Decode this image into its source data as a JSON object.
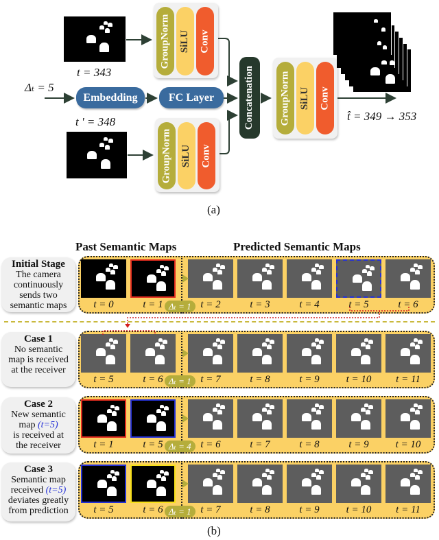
{
  "part_a": {
    "caption": "(a)",
    "input_top": {
      "label": "t = 343"
    },
    "input_bottom": {
      "label": "t ' = 348"
    },
    "delta_input": "Δₜ = 5",
    "embedding": "Embedding",
    "fc_layer": "FC Layer",
    "concatenation": "Concatenation",
    "block_layers": [
      "GroupNorm",
      "SiLU",
      "Conv"
    ],
    "output_label": "t̂ = 349 → 353",
    "colors": {
      "groupnorm": "#b5ad3b",
      "silu": "#fbd165",
      "conv": "#f05c2d",
      "blue_block": "#3a6b9e",
      "concat": "#26392c"
    }
  },
  "part_b": {
    "caption": "(b)",
    "headers": {
      "past": "Past Semantic Maps",
      "predicted": "Predicted Semantic Maps"
    },
    "rows": [
      {
        "title": "Initial Stage",
        "desc": [
          "The camera",
          "continuously",
          "sends two",
          "semantic maps"
        ],
        "past": [
          {
            "t": "t = 0",
            "style": "black"
          },
          {
            "t": "t = 1",
            "style": "black-red"
          }
        ],
        "delta": "Δₜ = 1",
        "predicted": [
          {
            "t": "t = 2"
          },
          {
            "t": "t = 3"
          },
          {
            "t": "t = 4"
          },
          {
            "t": "t = 5",
            "highlight": "dashed-blue"
          },
          {
            "t": "t = 6"
          }
        ]
      },
      {
        "title": "Case 1",
        "desc": [
          "No semantic",
          "map is received",
          "at the receiver"
        ],
        "past": [
          {
            "t": "t = 5",
            "style": "gray"
          },
          {
            "t": "t = 6",
            "style": "gray"
          }
        ],
        "delta": "Δₜ = 1",
        "predicted": [
          {
            "t": "t = 7"
          },
          {
            "t": "t = 8"
          },
          {
            "t": "t = 9"
          },
          {
            "t": "t = 10"
          },
          {
            "t": "t = 11"
          }
        ]
      },
      {
        "title": "Case 2",
        "desc": [
          "New semantic",
          "map (t=5)",
          "is received at",
          "the receiver"
        ],
        "past": [
          {
            "t": "t = 1",
            "style": "black-red"
          },
          {
            "t": "t = 5",
            "style": "black-blue"
          }
        ],
        "delta": "Δₜ = 4",
        "predicted": [
          {
            "t": "t = 6"
          },
          {
            "t": "t = 7"
          },
          {
            "t": "t = 8"
          },
          {
            "t": "t = 9"
          },
          {
            "t": "t = 10"
          }
        ]
      },
      {
        "title": "Case 3",
        "desc": [
          "Semantic map",
          "received (t=5)",
          "deviates greatly",
          "from prediction"
        ],
        "past": [
          {
            "t": "t = 5",
            "style": "black-blue"
          },
          {
            "t": "t = 6",
            "style": "black-yellow"
          }
        ],
        "delta": "Δₜ = 1",
        "predicted": [
          {
            "t": "t = 7"
          },
          {
            "t": "t = 8"
          },
          {
            "t": "t = 9"
          },
          {
            "t": "t = 10"
          },
          {
            "t": "t = 11"
          }
        ]
      }
    ],
    "highlight_text": "(t=5)",
    "colors": {
      "row_bg": "#fbd165",
      "predicted_map": "#5d5d5d",
      "red_border": "#e12c1f",
      "blue_border": "#2531d6",
      "yellow_border": "#f7e018",
      "separator": "#c9b93d",
      "connector": "#d21e1e"
    }
  }
}
